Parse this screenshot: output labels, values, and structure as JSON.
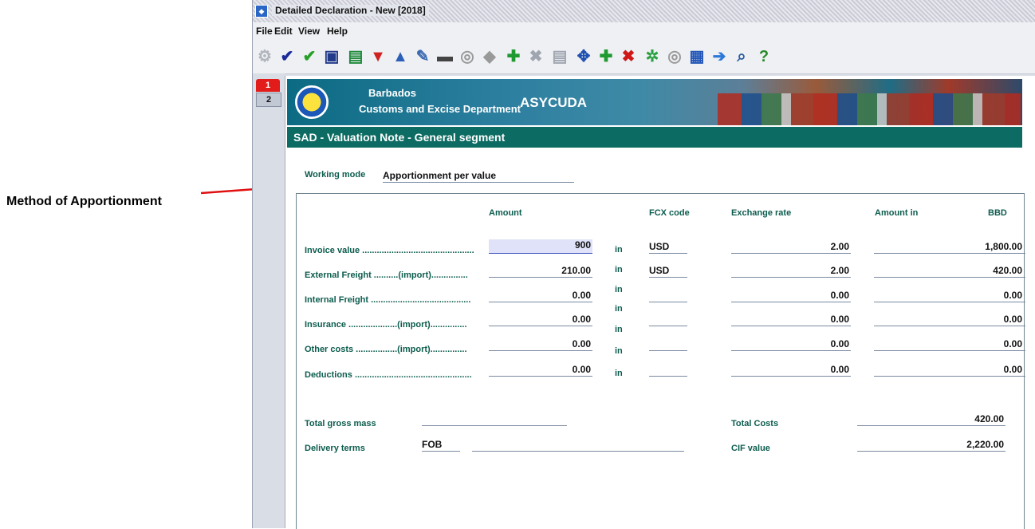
{
  "annotation": {
    "label": "Method of Apportionment"
  },
  "window": {
    "title": "Detailed Declaration - New [2018]"
  },
  "menu": [
    "File",
    "Edit",
    "View",
    "Help"
  ],
  "tabs": [
    "1",
    "2"
  ],
  "banner": {
    "country": "Barbados",
    "department": "Customs and Excise Department",
    "system": "ASYCUDA"
  },
  "segment_title": "SAD - Valuation Note - General segment",
  "working_mode": {
    "label": "Working mode",
    "value": "Apportionment per value"
  },
  "headers": {
    "amount": "Amount",
    "fcx": "FCX code",
    "rate": "Exchange rate",
    "amount_in": "Amount in",
    "currency": "BBD"
  },
  "in_label": "in",
  "rows": [
    {
      "label": "Invoice value ..............................................",
      "amount": "900",
      "fcx": "USD",
      "rate": "2.00",
      "bbd": "1,800.00"
    },
    {
      "label": "External Freight ..........(import)...............",
      "amount": "210.00",
      "fcx": "USD",
      "rate": "2.00",
      "bbd": "420.00"
    },
    {
      "label": "Internal Freight .........................................",
      "amount": "0.00",
      "fcx": "",
      "rate": "0.00",
      "bbd": "0.00"
    },
    {
      "label": "Insurance ....................(import)...............",
      "amount": "0.00",
      "fcx": "",
      "rate": "0.00",
      "bbd": "0.00"
    },
    {
      "label": "Other costs .................(import)...............",
      "amount": "0.00",
      "fcx": "",
      "rate": "0.00",
      "bbd": "0.00"
    },
    {
      "label": "Deductions ................................................",
      "amount": "0.00",
      "fcx": "",
      "rate": "0.00",
      "bbd": "0.00"
    }
  ],
  "totals": {
    "gross_mass_label": "Total gross mass",
    "gross_mass": "",
    "delivery_label": "Delivery terms",
    "delivery_code": "FOB",
    "delivery_place": "",
    "total_costs_label": "Total Costs",
    "total_costs": "420.00",
    "cif_label": "CIF value",
    "cif": "2,220.00"
  },
  "toolbar_icons": [
    "gears-icon",
    "check-icon",
    "validate-check-icon",
    "save-icon",
    "excel-icon",
    "xml-download-icon",
    "xml-upload-icon",
    "attach-icon",
    "print-icon",
    "view-icon",
    "cube-icon",
    "add-icon",
    "delete-icon",
    "document-icon",
    "expand-icon",
    "add-item-icon",
    "remove-item-icon",
    "network-icon",
    "glasses-icon",
    "sad-icon",
    "arrow-icon",
    "search-icon",
    "help-icon"
  ]
}
